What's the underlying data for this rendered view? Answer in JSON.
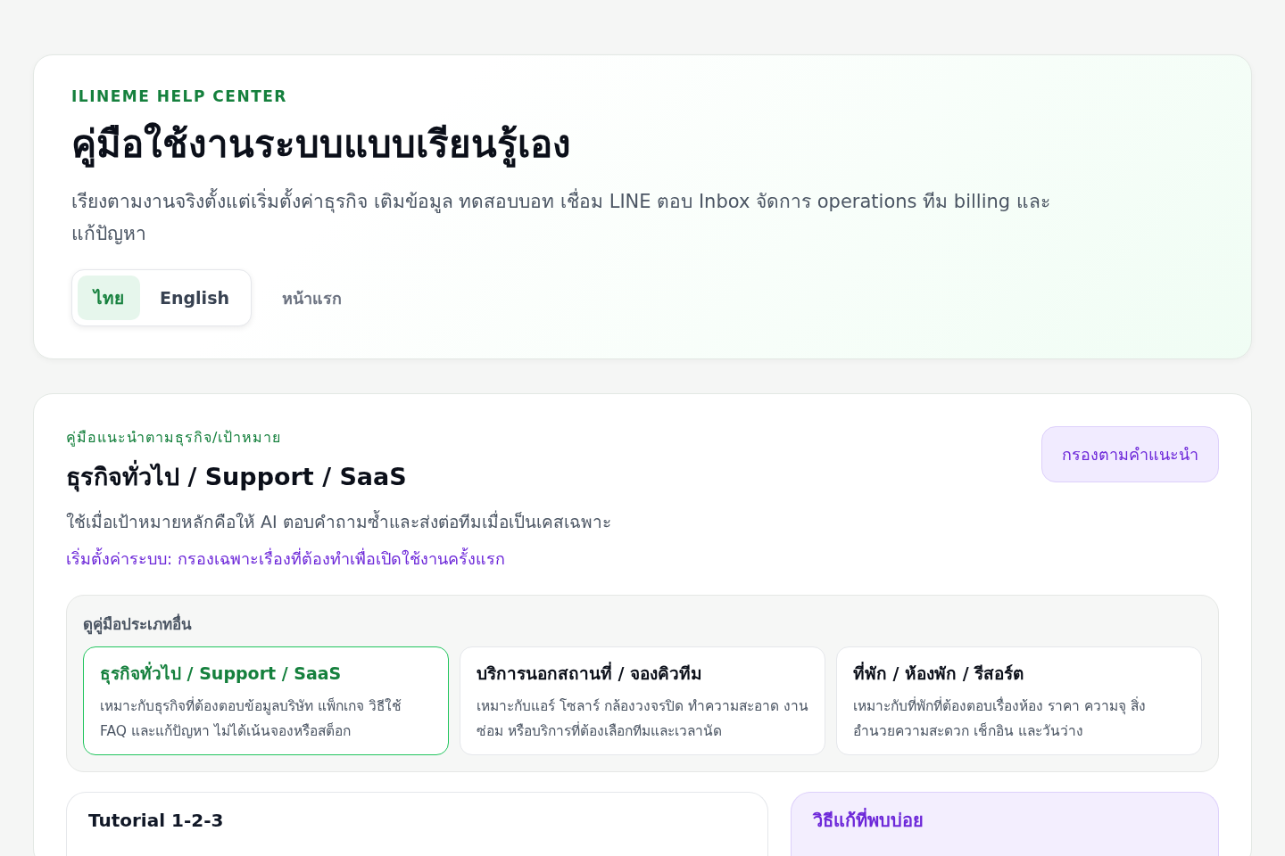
{
  "hero": {
    "eyebrow": "ILINEME HELP CENTER",
    "title": "คู่มือใช้งานระบบแบบเรียนรู้เอง",
    "description": "เรียงตามงานจริงตั้งแต่เริ่มตั้งค่าธุรกิจ เติมข้อมูล ทดสอบบอท เชื่อม LINE ตอบ Inbox จัดการ operations ทีม billing และแก้ปัญหา",
    "languages": [
      {
        "label": "ไทย",
        "selected": true
      },
      {
        "label": "English",
        "selected": false
      }
    ],
    "home_link": "หน้าแรก"
  },
  "guide": {
    "eyebrow": "คู่มือแนะนำตามธุรกิจ/เป้าหมาย",
    "title": "ธุรกิจทั่วไป / Support / SaaS",
    "description": "ใช้เมื่อเป้าหมายหลักคือให้ AI ตอบคำถามซ้ำและส่งต่อทีมเมื่อเป็นเคสเฉพาะ",
    "setup_link": "เริ่มตั้งค่าระบบ: กรองเฉพาะเรื่องที่ต้องทำเพื่อเปิดใช้งานครั้งแรก",
    "filter_button": "กรองตามคำแนะนำ",
    "other_types": {
      "label": "ดูคู่มือประเภทอื่น",
      "items": [
        {
          "title": "ธุรกิจทั่วไป / Support / SaaS",
          "description": "เหมาะกับธุรกิจที่ต้องตอบข้อมูลบริษัท แพ็กเกจ วิธีใช้ FAQ และแก้ปัญหา ไม่ได้เน้นจองหรือสต็อก",
          "selected": true
        },
        {
          "title": "บริการนอกสถานที่ / จองคิวทีม",
          "description": "เหมาะกับแอร์ โซลาร์ กล้องวงจรปิด ทำความสะอาด งานซ่อม หรือบริการที่ต้องเลือกทีมและเวลานัด",
          "selected": false
        },
        {
          "title": "ที่พัก / ห้องพัก / รีสอร์ต",
          "description": "เหมาะกับที่พักที่ต้องตอบเรื่องห้อง ราคา ความจุ สิ่งอำนวยความสะดวก เช็กอิน และวันว่าง",
          "selected": false
        }
      ]
    },
    "panels": [
      {
        "kind": "plain",
        "title": "Tutorial 1-2-3"
      },
      {
        "kind": "accent",
        "title": "วิธีแก้ที่พบบ่อย"
      }
    ]
  }
}
